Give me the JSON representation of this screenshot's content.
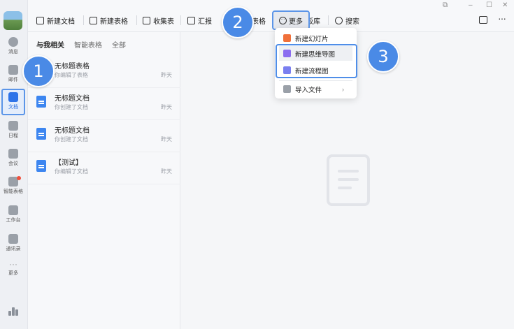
{
  "rail": {
    "items": [
      {
        "label": "消息",
        "icon": "chat-icon"
      },
      {
        "label": "邮件",
        "icon": "mail-icon"
      },
      {
        "label": "文档",
        "icon": "docs-icon"
      },
      {
        "label": "日程",
        "icon": "calendar-icon"
      },
      {
        "label": "会议",
        "icon": "meeting-icon"
      },
      {
        "label": "智能表格",
        "icon": "smart-sheet-icon"
      },
      {
        "label": "工作台",
        "icon": "workbench-icon"
      },
      {
        "label": "通讯录",
        "icon": "contacts-icon"
      },
      {
        "label": "更多",
        "icon": "more-icon"
      }
    ]
  },
  "toolbar": {
    "new_doc": "新建文档",
    "new_sheet": "新建表格",
    "collect_form": "收集表",
    "report": "汇报",
    "sheet_partial": "表格",
    "more": "更多",
    "templates": "模板库",
    "search": "搜索"
  },
  "window_controls": {
    "restore": "⧉",
    "minimize": "–",
    "maximize": "☐",
    "close": "✕"
  },
  "tabs": [
    "与我相关",
    "智能表格",
    "全部"
  ],
  "docs": [
    {
      "title": "无标题表格",
      "sub": "你编辑了表格",
      "date": "昨天",
      "kind": "sheet"
    },
    {
      "title": "无标题文档",
      "sub": "你创建了文档",
      "date": "昨天",
      "kind": "doc"
    },
    {
      "title": "无标题文档",
      "sub": "你创建了文档",
      "date": "昨天",
      "kind": "doc"
    },
    {
      "title": "【测试】",
      "sub": "你编辑了文档",
      "date": "昨天",
      "kind": "doc"
    }
  ],
  "menu": {
    "items": [
      {
        "label": "新建幻灯片",
        "color": "#f0703a"
      },
      {
        "label": "新建思维导图",
        "color": "#8a6cf0"
      },
      {
        "label": "新建流程图",
        "color": "#7a7ff0"
      },
      {
        "label": "导入文件",
        "color": "#9aa0a8"
      }
    ],
    "submenu_arrow": "›"
  },
  "badges": [
    "1",
    "2",
    "3"
  ],
  "colors": {
    "accent": "#2f74e8",
    "badge": "#4a8ae6"
  }
}
